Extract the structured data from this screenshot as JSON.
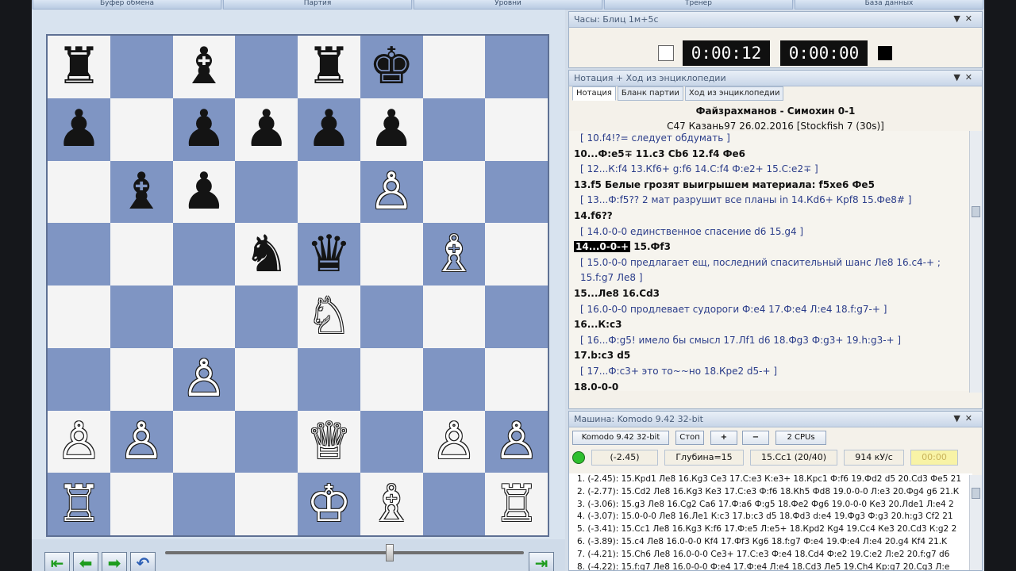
{
  "ribbon": [
    "Буфер обмена",
    "Партия",
    "Уровни",
    "Тренер",
    "База данных"
  ],
  "clock": {
    "title": "Часы: Блиц 1м+5с",
    "white_time": "0:00:12",
    "black_time": "0:00:00"
  },
  "notation": {
    "title": "Нотация + Ход из энциклопедии",
    "tabs": [
      "Нотация",
      "Бланк партии",
      "Ход из энциклопедии"
    ],
    "game_title": "Файзрахманов - Симохин  0-1",
    "game_info": "C47  Казань97 26.02.2016 [Stockfish 7 (30s)]",
    "lines": [
      {
        "t": "[  10.f4!?= следует обдумать ]",
        "c": true
      },
      {
        "t": "10...Ф:e5∓  11.c3  Cb6  12.f4  Фe6",
        "c": false
      },
      {
        "t": "[ 12...К:f4  13.Кf6+  g:f6  14.С:f4  Ф:e2+  15.С:e2∓ ]",
        "c": true
      },
      {
        "t": "13.f5  Белые грозят выигрышем материала: f5xe6   Фe5",
        "c": false
      },
      {
        "t": "[ 13...Ф:f5??  2 мат разрушит все планы in  14.Кd6+  Крf8  15.Фe8# ]",
        "c": true
      },
      {
        "t": "14.f6??",
        "c": false
      },
      {
        "t": "[  14.0-0-0 единственное спасение  d6  15.g4 ]",
        "c": true
      },
      {
        "t": "14...0-0-+  15.Фf3",
        "c": false,
        "hl": "14...0-0-+"
      },
      {
        "t": "[ 15.0-0-0 предлагает ещ, последний спасительный шанс  Лe8  16.c4-+ ;",
        "c": true
      },
      {
        "t": "15.f:g7  Лe8 ]",
        "c": true
      },
      {
        "t": "15...Лe8  16.Cd3",
        "c": false
      },
      {
        "t": "[ 16.0-0-0 продлевает судороги  Ф:e4  17.Ф:e4  Л:e4  18.f:g7-+ ]",
        "c": true
      },
      {
        "t": "16...К:c3",
        "c": false
      },
      {
        "t": "[  16...Ф:g5! имело бы смысл  17.Лf1  d6  18.Фg3  Ф:g3+  19.h:g3-+ ]",
        "c": true
      },
      {
        "t": "17.b:c3  d5",
        "c": false
      },
      {
        "t": "[  17...Ф:c3+ это то~~но  18.Крe2  d5-+ ]",
        "c": true
      },
      {
        "t": "18.0-0-0",
        "c": false
      }
    ]
  },
  "engine": {
    "title": "Машина: Komodo 9.42 32-bit",
    "name": "Komodo 9.42 32-bit",
    "stop": "Стоп",
    "plus": "+",
    "minus": "−",
    "cpus": "2 CPUs",
    "eval": "(-2.45)",
    "depth": "Глубина=15",
    "move": "15.Cc1 (20/40)",
    "speed": "914 кУ/с",
    "extra": "00:00",
    "pv": [
      "1. (-2.45): 15.Крd1 Лe8 16.Кg3 Ce3 17.С:e3 К:e3+ 18.Крc1 Ф:f6 19.Фd2 d5 20.Cd3 Фe5 21",
      "2. (-2.77): 15.Cd2 Лe8 16.Кg3 Кe3 17.С:e3 Ф:f6 18.Кh5 Фd8 19.0-0-0 Л:e3 20.Фg4 g6 21.К",
      "3. (-3.06): 15.g3 Лe8 16.Cg2 Ca6 17.Ф:a6 Ф:g5 18.Фe2 Фg6 19.0-0-0 Кe3 20.Лde1 Л:e4 2",
      "4. (-3.07): 15.0-0-0 Лe8 16.Лe1 К:c3 17.b:c3 d5 18.Фd3 d:e4 19.Фg3 Ф:g3 20.h:g3 Cf2 21",
      "5. (-3.41): 15.Cc1 Лe8 16.Кg3 К:f6 17.Ф:e5 Л:e5+ 18.Крd2 Кg4 19.Cc4 Кe3 20.Cd3 К:g2 2",
      "6. (-3.89): 15.c4 Лe8 16.0-0-0 Кf4 17.Фf3 Кg6 18.f:g7 Ф:e4 19.Ф:e4 Л:e4 20.g4 Кf4 21.K",
      "7. (-4.21): 15.Ch6 Лe8 16.0-0-0 Ce3+ 17.С:e3 Ф:e4 18.Cd4 Ф:e2 19.С:e2 Л:e2 20.f:g7 d6",
      "8. (-4.22): 15.f:g7 Лe8 16.0-0-0 Ф:e4 17.Ф:e4 Л:e4 18.Cd3 Лe5 19.Ch4 Кр:g7 20.Cg3 Л:e"
    ]
  },
  "board": [
    [
      "♜",
      "",
      "♝",
      "",
      "♜",
      "♚",
      "",
      ""
    ],
    [
      "♟",
      "",
      "♟",
      "♟",
      "♟",
      "♟",
      "",
      ""
    ],
    [
      "",
      "♝",
      "♟",
      "",
      "",
      "♙",
      "",
      ""
    ],
    [
      "",
      "",
      "",
      "♞",
      "♛",
      "",
      "♗",
      ""
    ],
    [
      "",
      "",
      "",
      "",
      "♘",
      "",
      "",
      ""
    ],
    [
      "",
      "",
      "♙",
      "",
      "",
      "",
      "",
      ""
    ],
    [
      "♙",
      "♙",
      "",
      "",
      "♕",
      "",
      "♙",
      "♙"
    ],
    [
      "♖",
      "",
      "",
      "",
      "♔",
      "♗",
      "",
      "♖"
    ]
  ],
  "colors": {
    "light": "#f4f4f4",
    "dark": "#7f95c3",
    "accent": "#1e9c1e"
  }
}
